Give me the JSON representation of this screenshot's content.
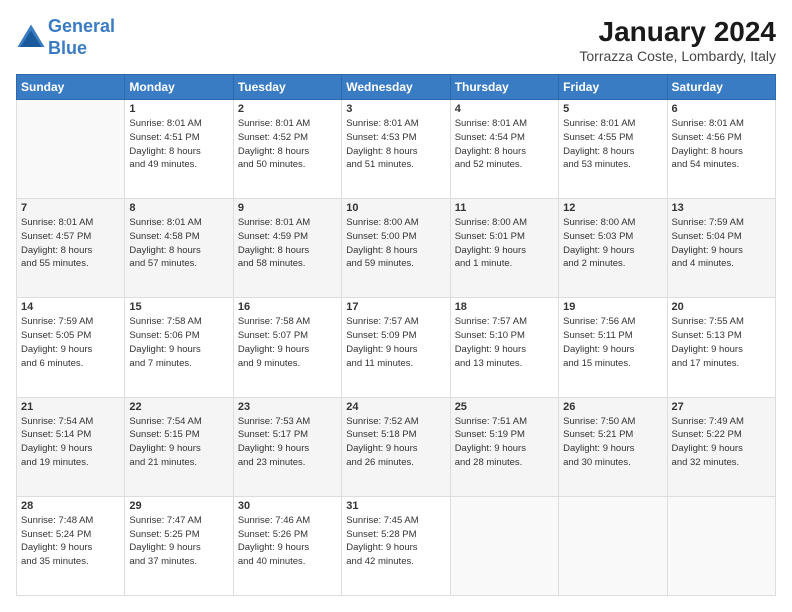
{
  "header": {
    "logo_line1": "General",
    "logo_line2": "Blue",
    "main_title": "January 2024",
    "subtitle": "Torrazza Coste, Lombardy, Italy"
  },
  "calendar": {
    "days_of_week": [
      "Sunday",
      "Monday",
      "Tuesday",
      "Wednesday",
      "Thursday",
      "Friday",
      "Saturday"
    ],
    "weeks": [
      [
        {
          "day": "",
          "info": ""
        },
        {
          "day": "1",
          "info": "Sunrise: 8:01 AM\nSunset: 4:51 PM\nDaylight: 8 hours\nand 49 minutes."
        },
        {
          "day": "2",
          "info": "Sunrise: 8:01 AM\nSunset: 4:52 PM\nDaylight: 8 hours\nand 50 minutes."
        },
        {
          "day": "3",
          "info": "Sunrise: 8:01 AM\nSunset: 4:53 PM\nDaylight: 8 hours\nand 51 minutes."
        },
        {
          "day": "4",
          "info": "Sunrise: 8:01 AM\nSunset: 4:54 PM\nDaylight: 8 hours\nand 52 minutes."
        },
        {
          "day": "5",
          "info": "Sunrise: 8:01 AM\nSunset: 4:55 PM\nDaylight: 8 hours\nand 53 minutes."
        },
        {
          "day": "6",
          "info": "Sunrise: 8:01 AM\nSunset: 4:56 PM\nDaylight: 8 hours\nand 54 minutes."
        }
      ],
      [
        {
          "day": "7",
          "info": "Sunrise: 8:01 AM\nSunset: 4:57 PM\nDaylight: 8 hours\nand 55 minutes."
        },
        {
          "day": "8",
          "info": "Sunrise: 8:01 AM\nSunset: 4:58 PM\nDaylight: 8 hours\nand 57 minutes."
        },
        {
          "day": "9",
          "info": "Sunrise: 8:01 AM\nSunset: 4:59 PM\nDaylight: 8 hours\nand 58 minutes."
        },
        {
          "day": "10",
          "info": "Sunrise: 8:00 AM\nSunset: 5:00 PM\nDaylight: 8 hours\nand 59 minutes."
        },
        {
          "day": "11",
          "info": "Sunrise: 8:00 AM\nSunset: 5:01 PM\nDaylight: 9 hours\nand 1 minute."
        },
        {
          "day": "12",
          "info": "Sunrise: 8:00 AM\nSunset: 5:03 PM\nDaylight: 9 hours\nand 2 minutes."
        },
        {
          "day": "13",
          "info": "Sunrise: 7:59 AM\nSunset: 5:04 PM\nDaylight: 9 hours\nand 4 minutes."
        }
      ],
      [
        {
          "day": "14",
          "info": "Sunrise: 7:59 AM\nSunset: 5:05 PM\nDaylight: 9 hours\nand 6 minutes."
        },
        {
          "day": "15",
          "info": "Sunrise: 7:58 AM\nSunset: 5:06 PM\nDaylight: 9 hours\nand 7 minutes."
        },
        {
          "day": "16",
          "info": "Sunrise: 7:58 AM\nSunset: 5:07 PM\nDaylight: 9 hours\nand 9 minutes."
        },
        {
          "day": "17",
          "info": "Sunrise: 7:57 AM\nSunset: 5:09 PM\nDaylight: 9 hours\nand 11 minutes."
        },
        {
          "day": "18",
          "info": "Sunrise: 7:57 AM\nSunset: 5:10 PM\nDaylight: 9 hours\nand 13 minutes."
        },
        {
          "day": "19",
          "info": "Sunrise: 7:56 AM\nSunset: 5:11 PM\nDaylight: 9 hours\nand 15 minutes."
        },
        {
          "day": "20",
          "info": "Sunrise: 7:55 AM\nSunset: 5:13 PM\nDaylight: 9 hours\nand 17 minutes."
        }
      ],
      [
        {
          "day": "21",
          "info": "Sunrise: 7:54 AM\nSunset: 5:14 PM\nDaylight: 9 hours\nand 19 minutes."
        },
        {
          "day": "22",
          "info": "Sunrise: 7:54 AM\nSunset: 5:15 PM\nDaylight: 9 hours\nand 21 minutes."
        },
        {
          "day": "23",
          "info": "Sunrise: 7:53 AM\nSunset: 5:17 PM\nDaylight: 9 hours\nand 23 minutes."
        },
        {
          "day": "24",
          "info": "Sunrise: 7:52 AM\nSunset: 5:18 PM\nDaylight: 9 hours\nand 26 minutes."
        },
        {
          "day": "25",
          "info": "Sunrise: 7:51 AM\nSunset: 5:19 PM\nDaylight: 9 hours\nand 28 minutes."
        },
        {
          "day": "26",
          "info": "Sunrise: 7:50 AM\nSunset: 5:21 PM\nDaylight: 9 hours\nand 30 minutes."
        },
        {
          "day": "27",
          "info": "Sunrise: 7:49 AM\nSunset: 5:22 PM\nDaylight: 9 hours\nand 32 minutes."
        }
      ],
      [
        {
          "day": "28",
          "info": "Sunrise: 7:48 AM\nSunset: 5:24 PM\nDaylight: 9 hours\nand 35 minutes."
        },
        {
          "day": "29",
          "info": "Sunrise: 7:47 AM\nSunset: 5:25 PM\nDaylight: 9 hours\nand 37 minutes."
        },
        {
          "day": "30",
          "info": "Sunrise: 7:46 AM\nSunset: 5:26 PM\nDaylight: 9 hours\nand 40 minutes."
        },
        {
          "day": "31",
          "info": "Sunrise: 7:45 AM\nSunset: 5:28 PM\nDaylight: 9 hours\nand 42 minutes."
        },
        {
          "day": "",
          "info": ""
        },
        {
          "day": "",
          "info": ""
        },
        {
          "day": "",
          "info": ""
        }
      ]
    ]
  }
}
